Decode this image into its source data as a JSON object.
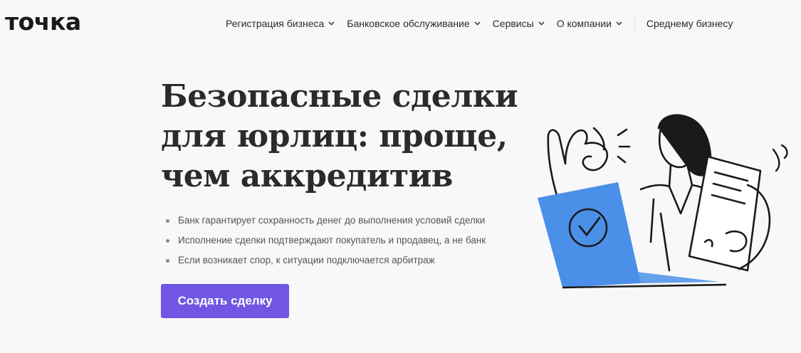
{
  "header": {
    "logo": "точка",
    "nav": [
      {
        "label": "Регистрация бизнеса"
      },
      {
        "label": "Банковское обслуживание"
      },
      {
        "label": "Сервисы"
      },
      {
        "label": "О компании"
      }
    ],
    "nav_plain": "Среднему бизнесу"
  },
  "hero": {
    "title_line1": "Безопасные сделки",
    "title_line2": "для юрлиц: проще,",
    "title_line3": "чем аккредитив",
    "bullets": [
      "Банк гарантирует сохранность денег до выполнения условий сделки",
      "Исполнение сделки подтверждают покупатель и продавец, а не банк",
      "Если возникает спор, к ситуации подключается арбитраж"
    ],
    "cta_label": "Создать сделку"
  },
  "colors": {
    "accent": "#7056e3",
    "illustration_blue": "#4a90e8",
    "background": "#f8f8fa"
  }
}
